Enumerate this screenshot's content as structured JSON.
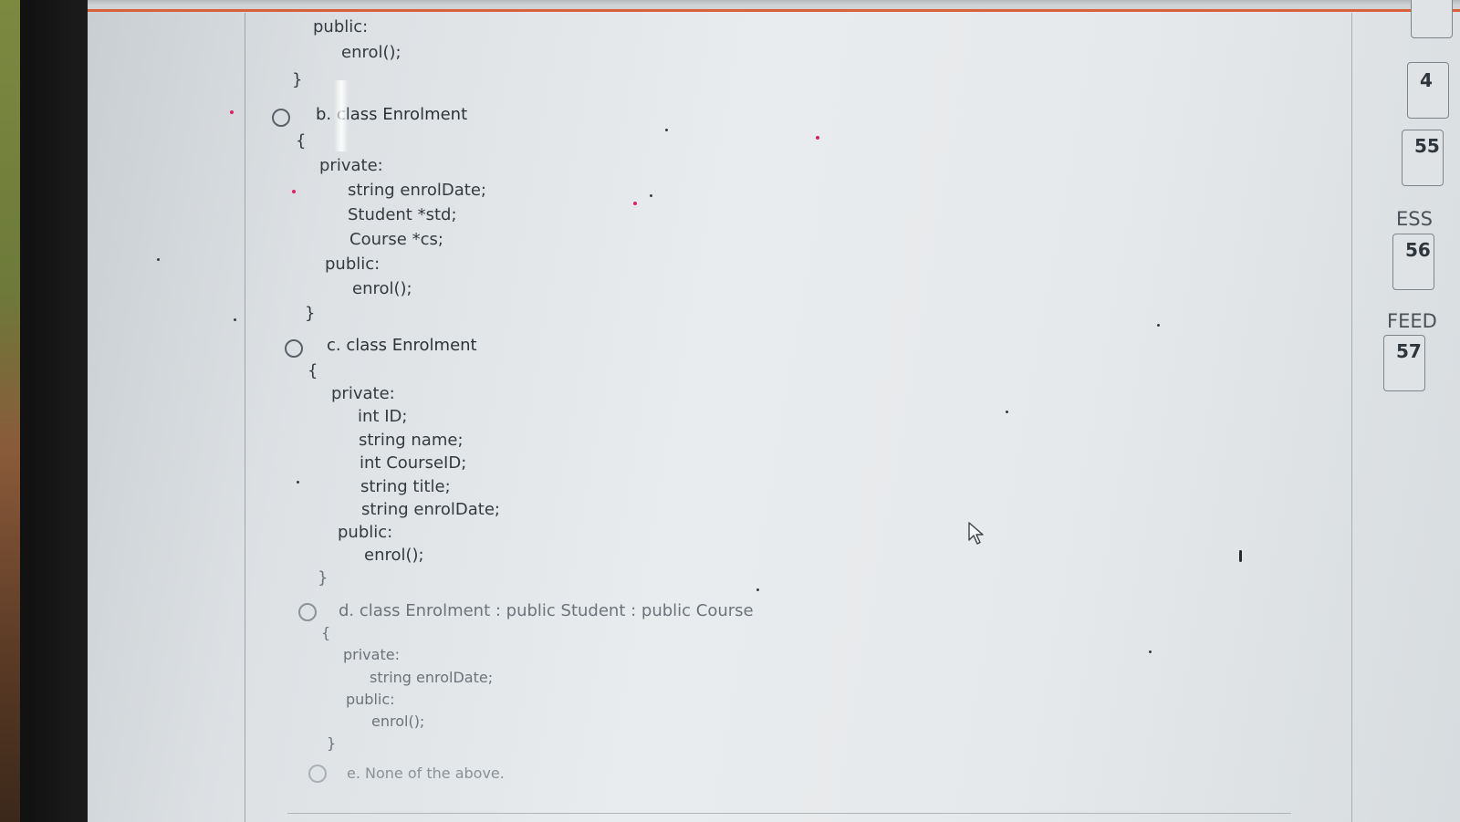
{
  "question": {
    "prev_option_tail": [
      "public:",
      "enrol();",
      "}"
    ],
    "options": [
      {
        "label": "b. class Enrolment",
        "code": [
          "{",
          "private:",
          "string enrolDate;",
          "Student *std;",
          "Course *cs;",
          "public:",
          "enrol();",
          "}"
        ]
      },
      {
        "label": "c. class Enrolment",
        "code": [
          "{",
          "private:",
          "int ID;",
          "string name;",
          "int CourseID;",
          "string title;",
          "string enrolDate;",
          "public:",
          "enrol();",
          "}"
        ]
      },
      {
        "label": "d. class Enrolment : public Student : public Course",
        "code": [
          "{",
          "private:",
          "string enrolDate;",
          "public:",
          "enrol();",
          "}"
        ]
      },
      {
        "label": "e. None of the above."
      }
    ]
  },
  "navigation": {
    "numbers": [
      "4",
      "55",
      "56",
      "57"
    ],
    "labels": [
      "ESS",
      "FEED"
    ]
  },
  "colors": {
    "accent_strip": "#d8613c"
  },
  "icons": [
    "radio-icon",
    "mouse-cursor-icon"
  ]
}
